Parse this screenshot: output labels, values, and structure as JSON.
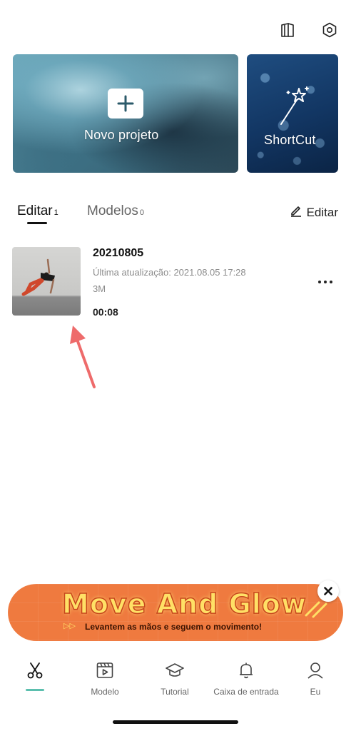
{
  "header": {
    "icons": [
      "book-icon",
      "settings-icon"
    ]
  },
  "cards": {
    "new_project": {
      "label": "Novo projeto",
      "icon": "plus-icon"
    },
    "shortcut": {
      "label": "ShortCut",
      "icon": "magic-wand-icon"
    }
  },
  "tabs": [
    {
      "label": "Editar",
      "count": "1",
      "active": true
    },
    {
      "label": "Modelos",
      "count": "0",
      "active": false
    }
  ],
  "edit_action": {
    "label": "Editar",
    "icon": "pencil-icon"
  },
  "project": {
    "title": "20210805",
    "updated": "Última atualização: 2021.08.05 17:28",
    "size": "3M",
    "duration": "00:08"
  },
  "banner": {
    "title": "Move And Glow",
    "subtitle": "Levantem as mãos e seguem o movimento!",
    "arrows": "▷▷"
  },
  "nav": [
    {
      "label": "",
      "icon": "scissors-icon",
      "active": true
    },
    {
      "label": "Modelo",
      "icon": "video-template-icon"
    },
    {
      "label": "Tutorial",
      "icon": "graduation-cap-icon"
    },
    {
      "label": "Caixa de entrada",
      "icon": "bell-icon"
    },
    {
      "label": "Eu",
      "icon": "user-icon"
    }
  ],
  "colors": {
    "accent": "#5bbfae",
    "banner": "#ef7a3f",
    "banner_text": "#ffe066",
    "arrow_annotation": "#ee6b6b"
  }
}
